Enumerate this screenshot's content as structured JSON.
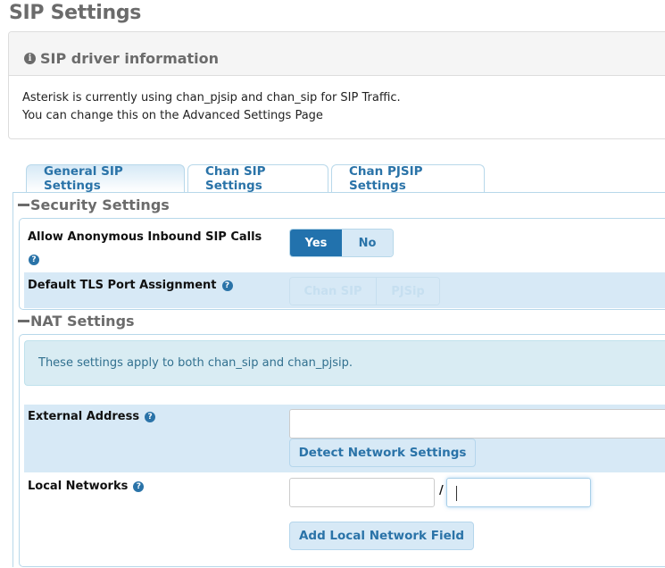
{
  "page": {
    "title": "SIP Settings"
  },
  "info_panel": {
    "icon": "info-circle-icon",
    "title": "SIP driver information",
    "lines": [
      "Asterisk is currently using chan_pjsip and chan_sip for SIP Traffic.",
      "You can change this on the Advanced Settings Page"
    ]
  },
  "tabs": [
    {
      "label": "General SIP Settings",
      "active": true
    },
    {
      "label": "Chan SIP Settings",
      "active": false
    },
    {
      "label": "Chan PJSIP Settings",
      "active": false
    }
  ],
  "security": {
    "title": "Security Settings",
    "allow_anonymous": {
      "label": "Allow Anonymous Inbound SIP Calls",
      "options": [
        "Yes",
        "No"
      ],
      "selected": "Yes"
    },
    "tls_port": {
      "label": "Default TLS Port Assignment",
      "options": [
        "Chan SIP",
        "PJSip"
      ],
      "disabled": true
    }
  },
  "nat": {
    "title": "NAT Settings",
    "alert": "These settings apply to both chan_sip and chan_pjsip.",
    "external_address": {
      "label": "External Address",
      "value": "",
      "button": "Detect Network Settings"
    },
    "local_networks": {
      "label": "Local Networks",
      "network_value": "",
      "separator": "/",
      "cidr_value": "",
      "button": "Add Local Network Field"
    }
  }
}
